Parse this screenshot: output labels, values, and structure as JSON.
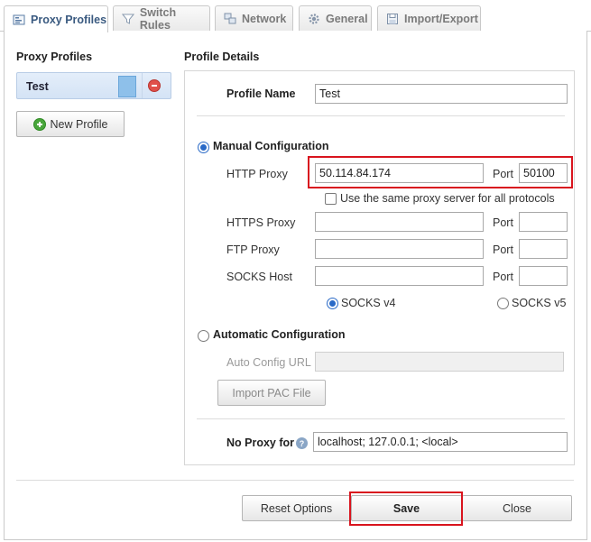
{
  "tabs": [
    {
      "label": "Proxy Profiles",
      "icon": "profiles-icon"
    },
    {
      "label": "Switch Rules",
      "icon": "filter-icon"
    },
    {
      "label": "Network",
      "icon": "network-icon"
    },
    {
      "label": "General",
      "icon": "gear-icon"
    },
    {
      "label": "Import/Export",
      "icon": "save-icon"
    }
  ],
  "sidebar": {
    "title": "Proxy Profiles",
    "profiles": [
      {
        "name": "Test",
        "color": "#8ec0ea"
      }
    ],
    "new_profile_label": "New Profile"
  },
  "details": {
    "title": "Profile Details",
    "profile_name_label": "Profile Name",
    "profile_name_value": "Test",
    "manual": {
      "label": "Manual Configuration",
      "selected": true,
      "http_label": "HTTP Proxy",
      "http_value": "50.114.84.174",
      "port_label": "Port",
      "http_port": "50100",
      "same_proxy_label": "Use the same proxy server for all protocols",
      "same_proxy_checked": false,
      "https_label": "HTTPS Proxy",
      "https_value": "",
      "https_port": "",
      "ftp_label": "FTP Proxy",
      "ftp_value": "",
      "ftp_port": "",
      "socks_label": "SOCKS Host",
      "socks_value": "",
      "socks_port": "",
      "socks_v4_label": "SOCKS v4",
      "socks_v4_selected": true,
      "socks_v5_label": "SOCKS v5",
      "socks_v5_selected": false
    },
    "auto": {
      "label": "Automatic Configuration",
      "selected": false,
      "url_label": "Auto Config URL",
      "url_value": "",
      "import_pac_label": "Import PAC File"
    },
    "no_proxy_label": "No Proxy for",
    "no_proxy_value": "localhost; 127.0.0.1; <local>"
  },
  "footer": {
    "reset_label": "Reset Options",
    "save_label": "Save",
    "close_label": "Close"
  },
  "colors": {
    "highlight": "#d9141e",
    "accent": "#2a6ac7",
    "active_tab_text": "#3a5a80"
  }
}
